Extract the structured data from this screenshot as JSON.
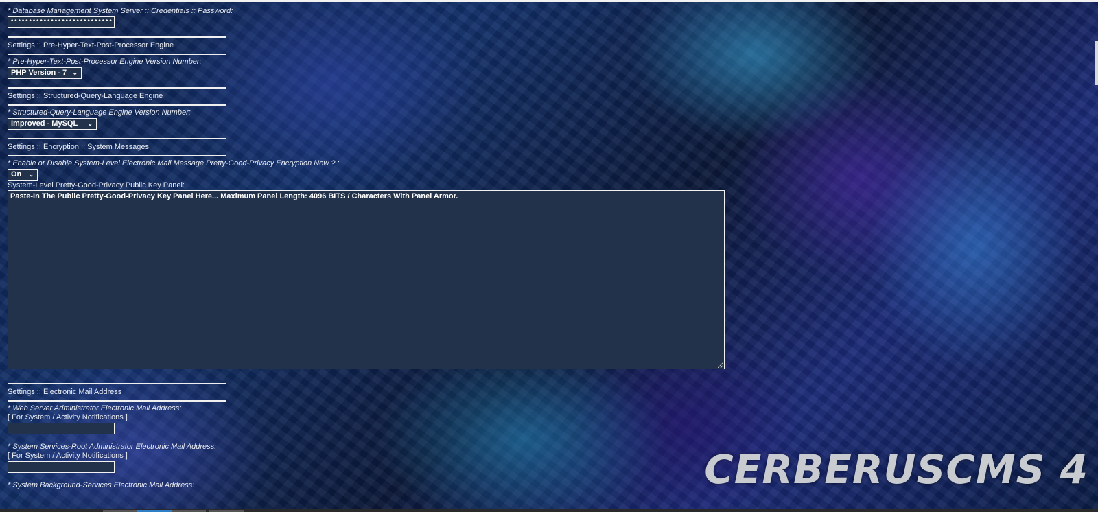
{
  "db_password": {
    "label": "* Database Management System Server :: Credentials :: Password:",
    "value": "••••••••••••••••••••••••••••"
  },
  "php_section": {
    "heading": "Settings :: Pre-Hyper-Text-Post-Processor Engine",
    "field_label": "* Pre-Hyper-Text-Post-Processor Engine Version Number:",
    "selected": "PHP Version - 7"
  },
  "sql_section": {
    "heading": "Settings :: Structured-Query-Language Engine",
    "field_label": "* Structured-Query-Language Engine Version Number:",
    "selected": "Improved - MySQL"
  },
  "encryption_section": {
    "heading": "Settings :: Encryption :: System Messages",
    "toggle_label": "* Enable or Disable System-Level Electronic Mail Message Pretty-Good-Privacy Encryption Now ? :",
    "toggle_value": "On",
    "key_panel_label": "System-Level Pretty-Good-Privacy Public Key Panel:",
    "key_panel_placeholder": "Paste-In The Public Pretty-Good-Privacy Key Panel Here... Maximum Panel Length: 4096 BITS / Characters With Panel Armor."
  },
  "email_section": {
    "heading": "Settings :: Electronic Mail Address",
    "webserver_admin_label": "* Web Server Administrator Electronic Mail Address:",
    "webserver_admin_note": "[ For System / Activity Notifications ]",
    "webserver_admin_value": "",
    "root_admin_label": "* System Services-Root Administrator Electronic Mail Address:",
    "root_admin_note": "[ For System / Activity Notifications ]",
    "root_admin_value": "",
    "background_label": "* System Background-Services Electronic Mail Address:"
  },
  "brand": {
    "text": "CERBERUSCMS 4"
  },
  "icons": {
    "select_chevron": "chevron-down-icon",
    "resize_grip": "resize-grip-icon"
  },
  "colors": {
    "input_bg": "#22324a",
    "border": "#f2f2f2",
    "brand_text": "#c8cbd0"
  }
}
